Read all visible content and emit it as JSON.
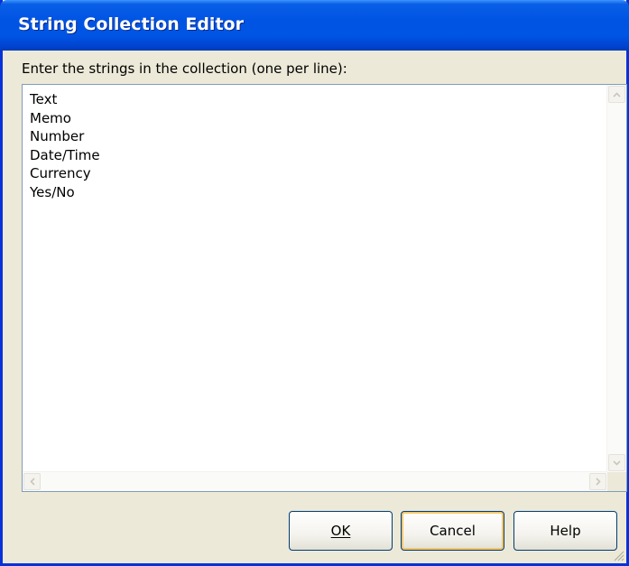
{
  "window": {
    "title": "String Collection Editor"
  },
  "prompt": "Enter the strings in the collection (one per line):",
  "lines": [
    "Text",
    "Memo",
    "Number",
    "Date/Time",
    "Currency",
    "Yes/No"
  ],
  "buttons": {
    "ok": "OK",
    "cancel": "Cancel",
    "help": "Help"
  },
  "icons": {
    "scroll_up": "chevron-up-icon",
    "scroll_down": "chevron-down-icon",
    "scroll_left": "chevron-left-icon",
    "scroll_right": "chevron-right-icon",
    "resize": "resize-grip-icon"
  },
  "colors": {
    "title_bar": "#0054e3",
    "window_face": "#ece9d8",
    "frame": "#0831d9"
  }
}
